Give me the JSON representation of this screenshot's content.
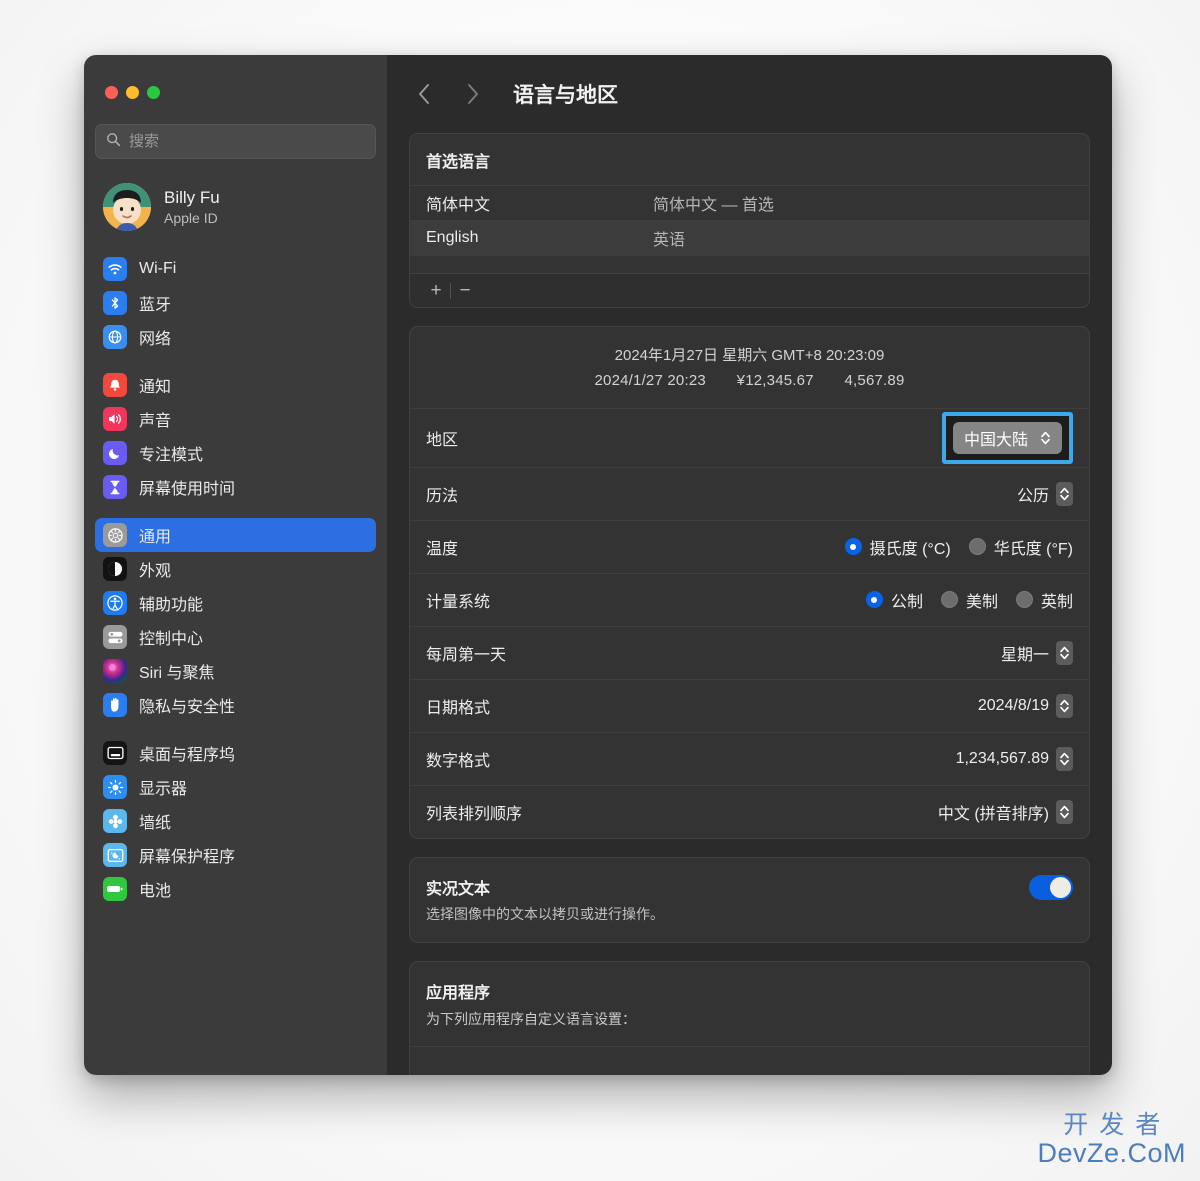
{
  "window": {
    "traffic_lights": [
      "close",
      "minimize",
      "zoom"
    ]
  },
  "sidebar": {
    "search": {
      "placeholder": "搜索",
      "value": "",
      "icon": "search-icon"
    },
    "account": {
      "name": "Billy Fu",
      "subtitle": "Apple ID",
      "avatar": "memoji-avatar"
    },
    "groups": [
      {
        "items": [
          {
            "label": "Wi-Fi",
            "icon": "wifi-icon",
            "color": "#2b7ef0",
            "selected": false
          },
          {
            "label": "蓝牙",
            "icon": "bluetooth-icon",
            "color": "#2b7ef0",
            "selected": false
          },
          {
            "label": "网络",
            "icon": "globe-icon",
            "color": "#3a8ef0",
            "selected": false
          }
        ]
      },
      {
        "items": [
          {
            "label": "通知",
            "icon": "bell-icon",
            "color": "#f4483c",
            "selected": false
          },
          {
            "label": "声音",
            "icon": "speaker-icon",
            "color": "#f1365c",
            "selected": false
          },
          {
            "label": "专注模式",
            "icon": "moon-icon",
            "color": "#6a5cf0",
            "selected": false
          },
          {
            "label": "屏幕使用时间",
            "icon": "hourglass-icon",
            "color": "#6a5cf0",
            "selected": false
          }
        ]
      },
      {
        "items": [
          {
            "label": "通用",
            "icon": "gear-icon",
            "color": "#9a9a9a",
            "selected": true
          },
          {
            "label": "外观",
            "icon": "appearance-icon",
            "color": "#121212",
            "selected": false
          },
          {
            "label": "辅助功能",
            "icon": "accessibility-icon",
            "color": "#1e7cf0",
            "selected": false
          },
          {
            "label": "控制中心",
            "icon": "control-center-icon",
            "color": "#9a9a9a",
            "selected": false
          },
          {
            "label": "Siri 与聚焦",
            "icon": "siri-icon",
            "color": "#7a2b6a",
            "selected": false
          },
          {
            "label": "隐私与安全性",
            "icon": "hand-icon",
            "color": "#2b7ef0",
            "selected": false
          }
        ]
      },
      {
        "items": [
          {
            "label": "桌面与程序坞",
            "icon": "desktop-dock-icon",
            "color": "#141414",
            "selected": false
          },
          {
            "label": "显示器",
            "icon": "brightness-icon",
            "color": "#2b8ef0",
            "selected": false
          },
          {
            "label": "墙纸",
            "icon": "wallpaper-icon",
            "color": "#5cb8ec",
            "selected": false
          },
          {
            "label": "屏幕保护程序",
            "icon": "screensaver-icon",
            "color": "#5cb8ec",
            "selected": false
          },
          {
            "label": "电池",
            "icon": "battery-icon",
            "color": "#31c840",
            "selected": false
          }
        ]
      }
    ]
  },
  "toolbar": {
    "back_icon": "chevron-left-icon",
    "forward_icon": "chevron-right-icon",
    "title": "语言与地区"
  },
  "preferred_languages": {
    "header": "首选语言",
    "rows": [
      {
        "name": "简体中文",
        "desc": "简体中文 — 首选",
        "selected": false
      },
      {
        "name": "English",
        "desc": "英语",
        "selected": true
      }
    ],
    "add_label": "+",
    "remove_label": "−"
  },
  "region_card": {
    "preview_line1": "2024年1月27日 星期六 GMT+8 20:23:09",
    "preview_date": "2024/1/27 20:23",
    "preview_currency": "¥12,345.67",
    "preview_number": "4,567.89",
    "rows": {
      "region": {
        "label": "地区",
        "value": "中国大陆",
        "focused": true,
        "focus_color": "#3fa8e8"
      },
      "calendar": {
        "label": "历法",
        "value": "公历"
      },
      "temperature": {
        "label": "温度",
        "options": [
          {
            "label": "摄氏度 (°C)",
            "selected": true
          },
          {
            "label": "华氏度 (°F)",
            "selected": false
          }
        ]
      },
      "measurement": {
        "label": "计量系统",
        "options": [
          {
            "label": "公制",
            "selected": true
          },
          {
            "label": "美制",
            "selected": false
          },
          {
            "label": "英制",
            "selected": false
          }
        ]
      },
      "first_day": {
        "label": "每周第一天",
        "value": "星期一"
      },
      "date_format": {
        "label": "日期格式",
        "value": "2024/8/19"
      },
      "number_format": {
        "label": "数字格式",
        "value": "1,234,567.89"
      },
      "sort_order": {
        "label": "列表排列顺序",
        "value": "中文 (拼音排序)"
      }
    }
  },
  "live_text": {
    "title": "实况文本",
    "subtitle": "选择图像中的文本以拷贝或进行操作。",
    "enabled": true,
    "accent": "#0a5fe0"
  },
  "applications": {
    "title": "应用程序",
    "subtitle": "为下列应用程序自定义语言设置：",
    "add_label": "+",
    "remove_label": "−"
  },
  "watermark": {
    "cn": "开发者",
    "en": "DevZe.CoM",
    "color": "#4b7ebd"
  }
}
